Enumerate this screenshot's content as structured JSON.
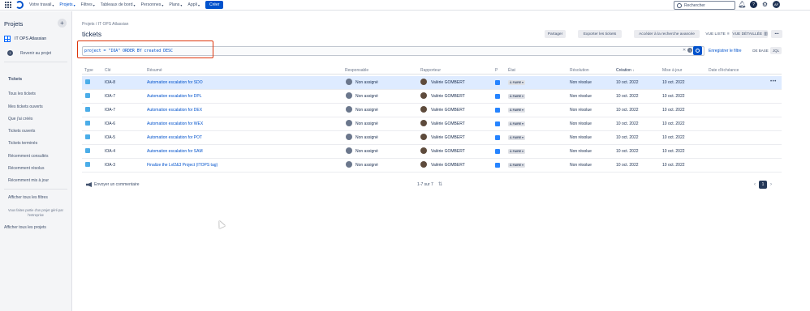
{
  "topnav": {
    "items": [
      {
        "label": "Votre travail"
      },
      {
        "label": "Projets"
      },
      {
        "label": "Filtres"
      },
      {
        "label": "Tableaux de bord"
      },
      {
        "label": "Personnes"
      },
      {
        "label": "Plans"
      },
      {
        "label": "Appli"
      }
    ],
    "create_label": "Créer",
    "search_placeholder": "Rechercher",
    "avatar_initials": "AF"
  },
  "sidebar": {
    "title": "Projets",
    "project_name": "IT OPS Atlassian",
    "back_label": "Revenir au projet",
    "section_heading": "Tickets",
    "links": [
      {
        "label": "Tous les tickets"
      },
      {
        "label": "Mes tickets ouverts"
      },
      {
        "label": "Que j'ai créés"
      },
      {
        "label": "Tickets ouverts"
      },
      {
        "label": "Tickets terminés"
      },
      {
        "label": "Récemment consultés"
      },
      {
        "label": "Récemment résolus"
      },
      {
        "label": "Récemment mis à jour"
      }
    ],
    "all_filters": "Afficher tous les filtres",
    "note": "Vous faites partie d'un projet géré par l'entreprise",
    "all_projects": "Afficher tous les projets"
  },
  "header": {
    "breadcrumb": "Projets  /  IT OPS Atlassian",
    "title": "tickets",
    "share": "Partager",
    "export": "Exporter les tickets",
    "advanced": "Accéder à la recherche avancée",
    "list_view": "VUE LISTE",
    "detail_view": "VUE DÉTAILLÉE"
  },
  "jql": {
    "query": "project = \"IOA\" ORDER BY created DESC",
    "save_filter": "Enregistrer le filtre",
    "basic": "DE BASE",
    "jql": "JQL"
  },
  "table": {
    "columns": {
      "type": "Type",
      "key": "Clé",
      "summary": "Résumé",
      "assignee": "Responsable",
      "reporter": "Rapporteur",
      "priority": "P",
      "status": "État",
      "resolution": "Résolution",
      "created": "Création",
      "updated": "Mise à jour",
      "due": "Date d'échéance"
    },
    "rows": [
      {
        "key": "IOA-8",
        "summary": "Automation escalation for SDO",
        "assignee": "Non assigné",
        "reporter": "Valérie GOMBERT",
        "status": "À FAIRE",
        "resolution": "Non résolue",
        "created": "10 oct. 2022",
        "updated": "10 oct. 2022"
      },
      {
        "key": "IOA-7",
        "summary": "Automation escalation for DPL",
        "assignee": "Non assigné",
        "reporter": "Valérie GOMBERT",
        "status": "À FAIRE",
        "resolution": "Non résolue",
        "created": "10 oct. 2022",
        "updated": "10 oct. 2022"
      },
      {
        "key": "IOA-7",
        "summary": "Automation escalation for DEX",
        "assignee": "Non assigné",
        "reporter": "Valérie GOMBERT",
        "status": "À FAIRE",
        "resolution": "Non résolue",
        "created": "10 oct. 2022",
        "updated": "10 oct. 2022"
      },
      {
        "key": "IOA-6",
        "summary": "Automation escalation for WEX",
        "assignee": "Non assigné",
        "reporter": "Valérie GOMBERT",
        "status": "À FAIRE",
        "resolution": "Non résolue",
        "created": "10 oct. 2022",
        "updated": "10 oct. 2022"
      },
      {
        "key": "IOA-5",
        "summary": "Automation escalation for POT",
        "assignee": "Non assigné",
        "reporter": "Valérie GOMBERT",
        "status": "À FAIRE",
        "resolution": "Non résolue",
        "created": "10 oct. 2022",
        "updated": "10 oct. 2022"
      },
      {
        "key": "IOA-4",
        "summary": "Automation escalation for SAM",
        "assignee": "Non assigné",
        "reporter": "Valérie GOMBERT",
        "status": "À FAIRE",
        "resolution": "Non résolue",
        "created": "10 oct. 2022",
        "updated": "10 oct. 2022"
      },
      {
        "key": "IOA-3",
        "summary": "Finalize the Lvl2&3 Project (ITOPS tag)",
        "assignee": "Non assigné",
        "reporter": "Valérie GOMBERT",
        "status": "À FAIRE",
        "resolution": "Non résolue",
        "created": "10 oct. 2022",
        "updated": "10 oct. 2022"
      }
    ]
  },
  "footer": {
    "feedback": "Envoyer un commentaire",
    "count": "1-7 sur 7",
    "current_page": "1"
  }
}
